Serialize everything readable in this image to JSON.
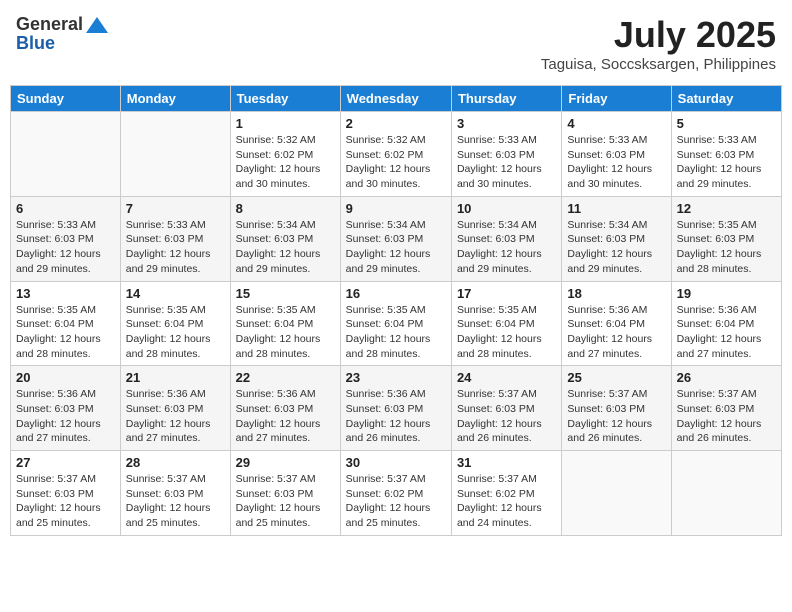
{
  "header": {
    "logo_general": "General",
    "logo_blue": "Blue",
    "month_title": "July 2025",
    "location": "Taguisa, Soccsksargen, Philippines"
  },
  "weekdays": [
    "Sunday",
    "Monday",
    "Tuesday",
    "Wednesday",
    "Thursday",
    "Friday",
    "Saturday"
  ],
  "weeks": [
    [
      {
        "day": "",
        "sunrise": "",
        "sunset": "",
        "daylight": ""
      },
      {
        "day": "",
        "sunrise": "",
        "sunset": "",
        "daylight": ""
      },
      {
        "day": "1",
        "sunrise": "Sunrise: 5:32 AM",
        "sunset": "Sunset: 6:02 PM",
        "daylight": "Daylight: 12 hours and 30 minutes."
      },
      {
        "day": "2",
        "sunrise": "Sunrise: 5:32 AM",
        "sunset": "Sunset: 6:02 PM",
        "daylight": "Daylight: 12 hours and 30 minutes."
      },
      {
        "day": "3",
        "sunrise": "Sunrise: 5:33 AM",
        "sunset": "Sunset: 6:03 PM",
        "daylight": "Daylight: 12 hours and 30 minutes."
      },
      {
        "day": "4",
        "sunrise": "Sunrise: 5:33 AM",
        "sunset": "Sunset: 6:03 PM",
        "daylight": "Daylight: 12 hours and 30 minutes."
      },
      {
        "day": "5",
        "sunrise": "Sunrise: 5:33 AM",
        "sunset": "Sunset: 6:03 PM",
        "daylight": "Daylight: 12 hours and 29 minutes."
      }
    ],
    [
      {
        "day": "6",
        "sunrise": "Sunrise: 5:33 AM",
        "sunset": "Sunset: 6:03 PM",
        "daylight": "Daylight: 12 hours and 29 minutes."
      },
      {
        "day": "7",
        "sunrise": "Sunrise: 5:33 AM",
        "sunset": "Sunset: 6:03 PM",
        "daylight": "Daylight: 12 hours and 29 minutes."
      },
      {
        "day": "8",
        "sunrise": "Sunrise: 5:34 AM",
        "sunset": "Sunset: 6:03 PM",
        "daylight": "Daylight: 12 hours and 29 minutes."
      },
      {
        "day": "9",
        "sunrise": "Sunrise: 5:34 AM",
        "sunset": "Sunset: 6:03 PM",
        "daylight": "Daylight: 12 hours and 29 minutes."
      },
      {
        "day": "10",
        "sunrise": "Sunrise: 5:34 AM",
        "sunset": "Sunset: 6:03 PM",
        "daylight": "Daylight: 12 hours and 29 minutes."
      },
      {
        "day": "11",
        "sunrise": "Sunrise: 5:34 AM",
        "sunset": "Sunset: 6:03 PM",
        "daylight": "Daylight: 12 hours and 29 minutes."
      },
      {
        "day": "12",
        "sunrise": "Sunrise: 5:35 AM",
        "sunset": "Sunset: 6:03 PM",
        "daylight": "Daylight: 12 hours and 28 minutes."
      }
    ],
    [
      {
        "day": "13",
        "sunrise": "Sunrise: 5:35 AM",
        "sunset": "Sunset: 6:04 PM",
        "daylight": "Daylight: 12 hours and 28 minutes."
      },
      {
        "day": "14",
        "sunrise": "Sunrise: 5:35 AM",
        "sunset": "Sunset: 6:04 PM",
        "daylight": "Daylight: 12 hours and 28 minutes."
      },
      {
        "day": "15",
        "sunrise": "Sunrise: 5:35 AM",
        "sunset": "Sunset: 6:04 PM",
        "daylight": "Daylight: 12 hours and 28 minutes."
      },
      {
        "day": "16",
        "sunrise": "Sunrise: 5:35 AM",
        "sunset": "Sunset: 6:04 PM",
        "daylight": "Daylight: 12 hours and 28 minutes."
      },
      {
        "day": "17",
        "sunrise": "Sunrise: 5:35 AM",
        "sunset": "Sunset: 6:04 PM",
        "daylight": "Daylight: 12 hours and 28 minutes."
      },
      {
        "day": "18",
        "sunrise": "Sunrise: 5:36 AM",
        "sunset": "Sunset: 6:04 PM",
        "daylight": "Daylight: 12 hours and 27 minutes."
      },
      {
        "day": "19",
        "sunrise": "Sunrise: 5:36 AM",
        "sunset": "Sunset: 6:04 PM",
        "daylight": "Daylight: 12 hours and 27 minutes."
      }
    ],
    [
      {
        "day": "20",
        "sunrise": "Sunrise: 5:36 AM",
        "sunset": "Sunset: 6:03 PM",
        "daylight": "Daylight: 12 hours and 27 minutes."
      },
      {
        "day": "21",
        "sunrise": "Sunrise: 5:36 AM",
        "sunset": "Sunset: 6:03 PM",
        "daylight": "Daylight: 12 hours and 27 minutes."
      },
      {
        "day": "22",
        "sunrise": "Sunrise: 5:36 AM",
        "sunset": "Sunset: 6:03 PM",
        "daylight": "Daylight: 12 hours and 27 minutes."
      },
      {
        "day": "23",
        "sunrise": "Sunrise: 5:36 AM",
        "sunset": "Sunset: 6:03 PM",
        "daylight": "Daylight: 12 hours and 26 minutes."
      },
      {
        "day": "24",
        "sunrise": "Sunrise: 5:37 AM",
        "sunset": "Sunset: 6:03 PM",
        "daylight": "Daylight: 12 hours and 26 minutes."
      },
      {
        "day": "25",
        "sunrise": "Sunrise: 5:37 AM",
        "sunset": "Sunset: 6:03 PM",
        "daylight": "Daylight: 12 hours and 26 minutes."
      },
      {
        "day": "26",
        "sunrise": "Sunrise: 5:37 AM",
        "sunset": "Sunset: 6:03 PM",
        "daylight": "Daylight: 12 hours and 26 minutes."
      }
    ],
    [
      {
        "day": "27",
        "sunrise": "Sunrise: 5:37 AM",
        "sunset": "Sunset: 6:03 PM",
        "daylight": "Daylight: 12 hours and 25 minutes."
      },
      {
        "day": "28",
        "sunrise": "Sunrise: 5:37 AM",
        "sunset": "Sunset: 6:03 PM",
        "daylight": "Daylight: 12 hours and 25 minutes."
      },
      {
        "day": "29",
        "sunrise": "Sunrise: 5:37 AM",
        "sunset": "Sunset: 6:03 PM",
        "daylight": "Daylight: 12 hours and 25 minutes."
      },
      {
        "day": "30",
        "sunrise": "Sunrise: 5:37 AM",
        "sunset": "Sunset: 6:02 PM",
        "daylight": "Daylight: 12 hours and 25 minutes."
      },
      {
        "day": "31",
        "sunrise": "Sunrise: 5:37 AM",
        "sunset": "Sunset: 6:02 PM",
        "daylight": "Daylight: 12 hours and 24 minutes."
      },
      {
        "day": "",
        "sunrise": "",
        "sunset": "",
        "daylight": ""
      },
      {
        "day": "",
        "sunrise": "",
        "sunset": "",
        "daylight": ""
      }
    ]
  ]
}
